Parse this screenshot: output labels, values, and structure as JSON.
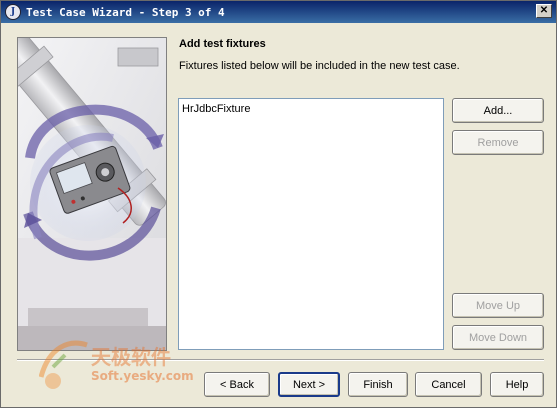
{
  "window": {
    "title": "Test Case Wizard - Step 3 of 4",
    "icon_letter": "J"
  },
  "content": {
    "heading": "Add test fixtures",
    "description": "Fixtures listed below will be included in the new test case."
  },
  "fixtures": [
    "HrJdbcFixture"
  ],
  "side_buttons": {
    "add": {
      "label": "Add...",
      "enabled": true
    },
    "remove": {
      "label": "Remove",
      "enabled": false
    },
    "move_up": {
      "label": "Move Up",
      "enabled": false
    },
    "move_down": {
      "label": "Move Down",
      "enabled": false
    }
  },
  "nav_buttons": {
    "back": {
      "label": "< Back",
      "enabled": true
    },
    "next": {
      "label": "Next >",
      "enabled": true
    },
    "finish": {
      "label": "Finish",
      "enabled": true
    },
    "cancel": {
      "label": "Cancel",
      "enabled": true
    },
    "help": {
      "label": "Help",
      "enabled": true
    }
  },
  "watermark": {
    "text_cn": "天极软件",
    "text_url": "Soft.yesky.com"
  }
}
